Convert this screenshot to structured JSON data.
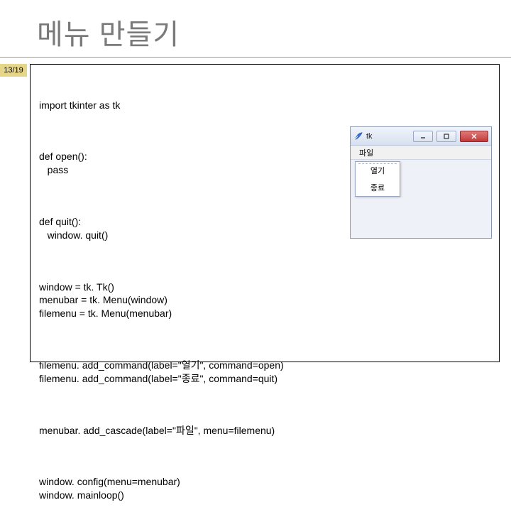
{
  "slide": {
    "title": "메뉴 만들기",
    "page": "13/19"
  },
  "code": {
    "b1": "import tkinter as tk",
    "b2": "def open():\n   pass",
    "b3": "def quit():\n   window. quit()",
    "b4": "window = tk. Tk()\nmenubar = tk. Menu(window)\nfilemenu = tk. Menu(menubar)",
    "b5": "filemenu. add_command(label=\"열기\", command=open)\nfilemenu. add_command(label=\"종료\", command=quit)",
    "b6": "menubar. add_cascade(label=\"파일\", menu=filemenu)",
    "b7": "window. config(menu=menubar)\nwindow. mainloop()"
  },
  "tk": {
    "title": "tk",
    "menu": {
      "file": "파일"
    },
    "dropdown": {
      "open": "열기",
      "quit": "종료"
    }
  }
}
